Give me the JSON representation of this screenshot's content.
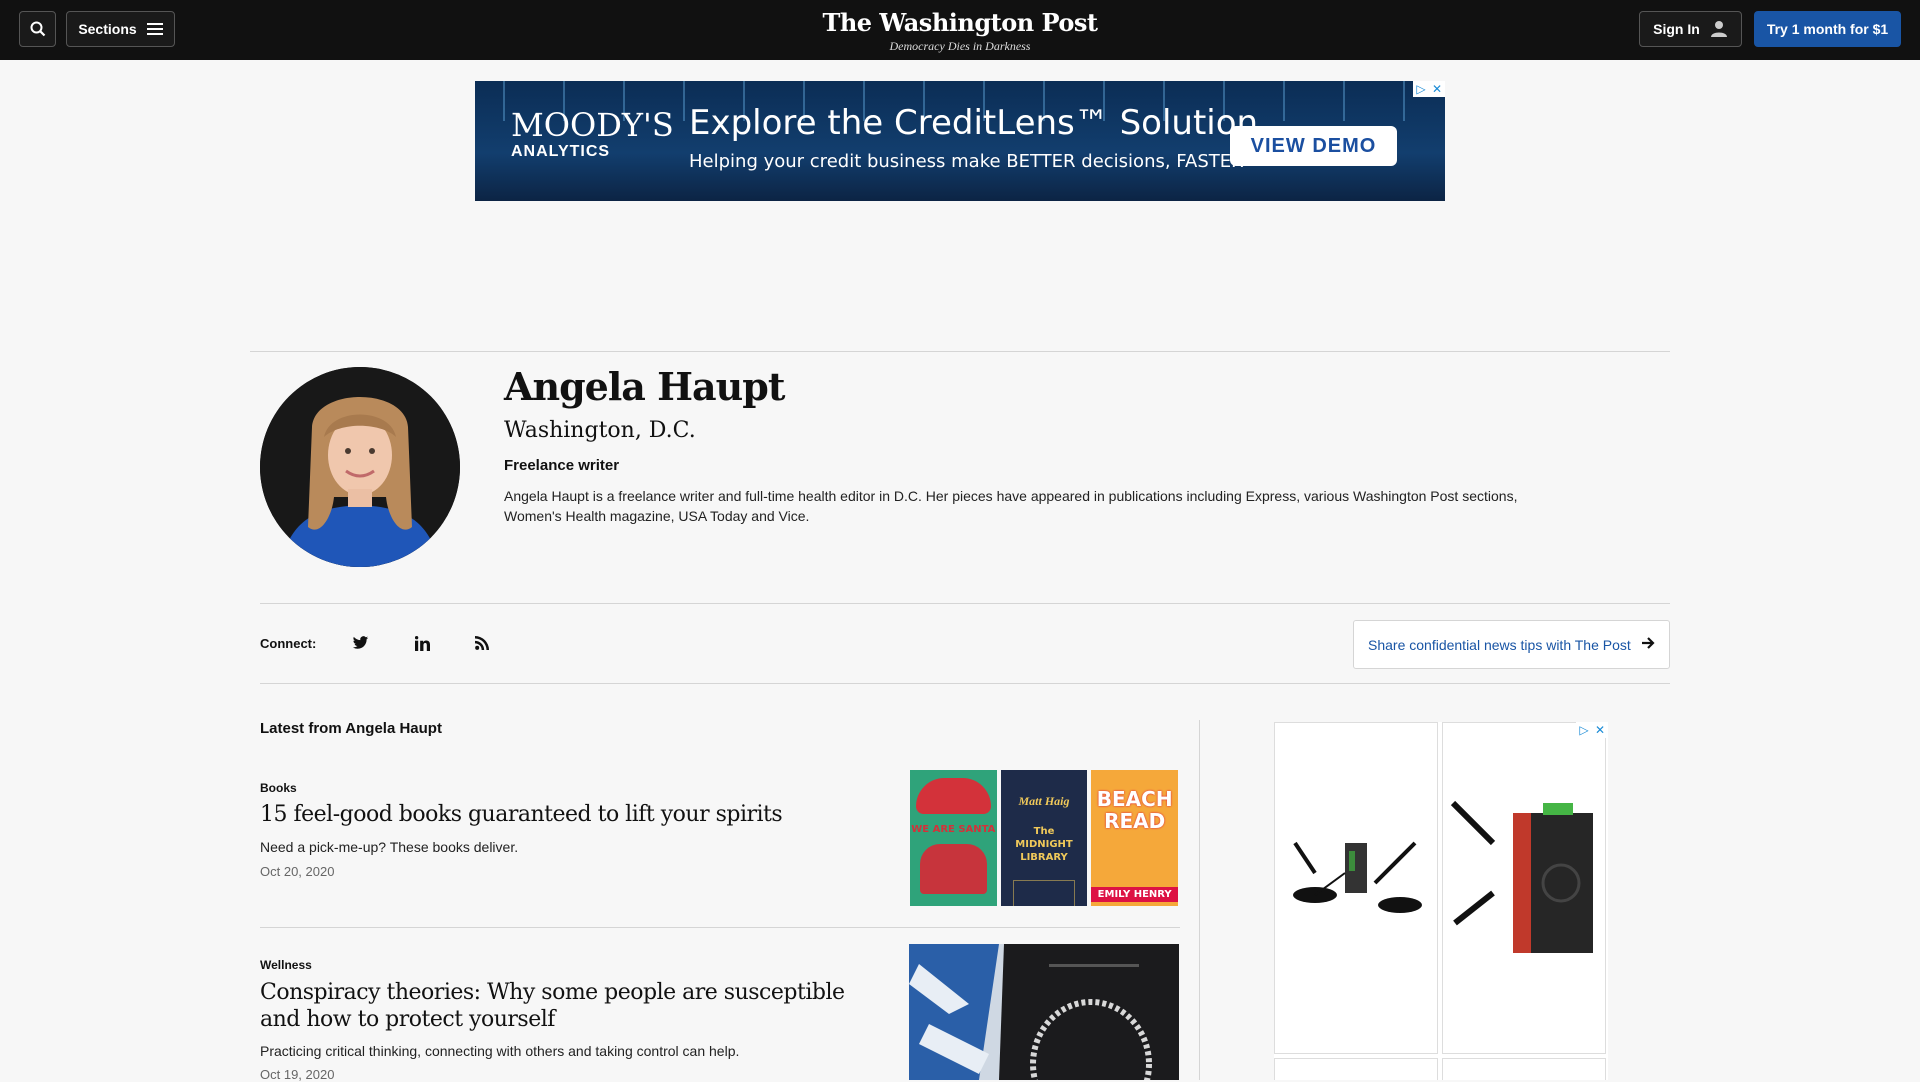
{
  "header": {
    "sections_label": "Sections",
    "masthead_title": "The Washington Post",
    "masthead_tagline": "Democracy Dies in Darkness",
    "signin_label": "Sign In",
    "trial_label": "Try 1 month for $1"
  },
  "top_ad": {
    "brand": "MOODY'S",
    "brand_sub": "ANALYTICS",
    "headline": "Explore the CreditLens™ Solution",
    "subline": "Helping your credit business make BETTER decisions, FASTER",
    "cta": "VIEW DEMO"
  },
  "author": {
    "name": "Angela Haupt",
    "location": "Washington, D.C.",
    "role": "Freelance writer",
    "bio": "Angela Haupt is a freelance writer and full-time health editor in D.C. Her pieces have appeared in publications including Express, various Washington Post sections, Women's Health magazine, USA Today and Vice."
  },
  "connect": {
    "label": "Connect:",
    "icons": [
      "twitter-icon",
      "linkedin-icon",
      "rss-icon"
    ],
    "tips_label": "Share confidential news tips with The Post"
  },
  "latest": {
    "heading": "Latest from Angela Haupt",
    "stories": [
      {
        "kicker": "Books",
        "title": "15 feel-good books guaranteed to lift your spirits",
        "blurb": "Need a pick-me-up? These books deliver.",
        "date": "Oct 20, 2020",
        "books": [
          "WE ARE SANTA",
          "The MIDNIGHT LIBRARY",
          "BEACH READ"
        ],
        "book_authors": [
          "Matt Haig",
          "EMILY HENRY"
        ]
      },
      {
        "kicker": "Wellness",
        "title": "Conspiracy theories: Why some people are susceptible and how to protect yourself",
        "blurb": "Practicing critical thinking, connecting with others and taking control can help.",
        "date": "Oct 19, 2020"
      }
    ]
  },
  "colors": {
    "topbar": "#111111",
    "accent": "#1955a5",
    "background": "#f7f7f7"
  }
}
